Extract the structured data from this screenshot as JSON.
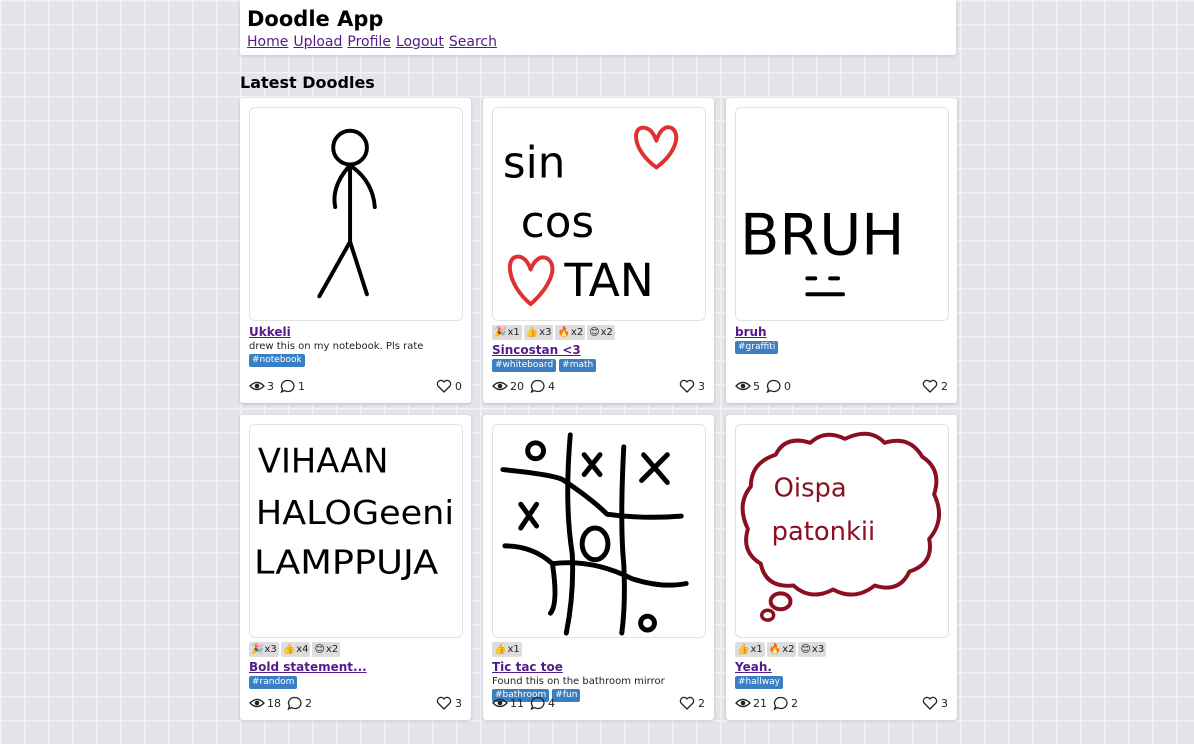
{
  "app": {
    "title": "Doodle App"
  },
  "nav": [
    {
      "label": "Home"
    },
    {
      "label": "Upload"
    },
    {
      "label": "Profile"
    },
    {
      "label": "Logout"
    },
    {
      "label": "Search"
    }
  ],
  "section_title": "Latest Doodles",
  "doodles": [
    {
      "title": "Ukkeli",
      "description": "drew this on my notebook. Pls rate",
      "tags": [
        "#notebook"
      ],
      "reactions": [],
      "views": "3",
      "comments": "1",
      "likes": "0"
    },
    {
      "title": "Sincostan <3",
      "description": "",
      "tags": [
        "#whiteboard",
        "#math"
      ],
      "reactions": [
        {
          "emoji": "🎉",
          "count": "x1"
        },
        {
          "emoji": "👍",
          "count": "x3"
        },
        {
          "emoji": "🔥",
          "count": "x2"
        },
        {
          "emoji": "😊",
          "count": "x2"
        }
      ],
      "views": "20",
      "comments": "4",
      "likes": "3"
    },
    {
      "title": "bruh",
      "description": "",
      "tags": [
        "#graffiti"
      ],
      "reactions": [],
      "views": "5",
      "comments": "0",
      "likes": "2"
    },
    {
      "title": "Bold statement...",
      "description": "",
      "tags": [
        "#random"
      ],
      "reactions": [
        {
          "emoji": "🎉",
          "count": "x3"
        },
        {
          "emoji": "👍",
          "count": "x4"
        },
        {
          "emoji": "😊",
          "count": "x2"
        }
      ],
      "views": "18",
      "comments": "2",
      "likes": "3"
    },
    {
      "title": "Tic tac toe",
      "description": "Found this on the bathroom mirror",
      "tags": [
        "#bathroom",
        "#fun"
      ],
      "reactions": [
        {
          "emoji": "👍",
          "count": "x1"
        }
      ],
      "views": "11",
      "comments": "4",
      "likes": "2"
    },
    {
      "title": "Yeah.",
      "description": "",
      "tags": [
        "#hallway"
      ],
      "reactions": [
        {
          "emoji": "👍",
          "count": "x1"
        },
        {
          "emoji": "🔥",
          "count": "x2"
        },
        {
          "emoji": "😊",
          "count": "x3"
        }
      ],
      "views": "21",
      "comments": "2",
      "likes": "3"
    }
  ],
  "drawing_text": {
    "d2_line1": "sin",
    "d2_line2": "cos",
    "d2_line3": "TAN",
    "d3_text": "BRUH",
    "d4_line1": "VIHAAN",
    "d4_line2": "HALOGeeni",
    "d4_line3": "LAMPPUJA",
    "d6_line1": "Oispa",
    "d6_line2": "patonkii"
  },
  "colors": {
    "link": "#551a8b",
    "tag": "#3a7fc3",
    "heart_red": "#e03030",
    "cloud": "#8a1020"
  }
}
